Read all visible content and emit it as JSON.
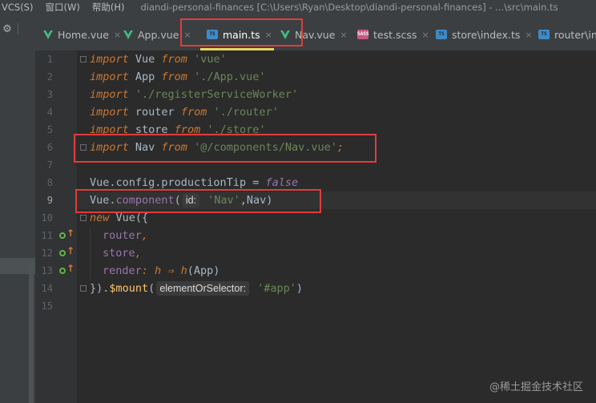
{
  "menu": {
    "items": [
      "VCS(S)",
      "窗口(W)",
      "帮助(H)"
    ],
    "title": "diandi-personal-finances [C:\\Users\\Ryan\\Desktop\\diandi-personal-finances] - ...\\src\\main.ts"
  },
  "left_panel": {
    "gear_icon": "gear-icon"
  },
  "tabs": [
    {
      "label": "Home.vue",
      "icon": "vue-icon"
    },
    {
      "label": "App.vue",
      "icon": "vue-icon"
    },
    {
      "label": "main.ts",
      "icon": "ts-file-icon",
      "badge": "TS",
      "active": true
    },
    {
      "label": "Nav.vue",
      "icon": "vue-icon"
    },
    {
      "label": "test.scss",
      "icon": "sass-file-icon",
      "badge": "SASS"
    },
    {
      "label": "store\\index.ts",
      "icon": "ts-file-icon",
      "badge": "TS"
    },
    {
      "label": "router\\in",
      "icon": "ts-file-icon",
      "badge": "TS"
    }
  ],
  "close_glyph": "×",
  "editor": {
    "line_numbers": [
      "1",
      "2",
      "3",
      "4",
      "5",
      "6",
      "7",
      "8",
      "9",
      "10",
      "11",
      "12",
      "13",
      "14",
      "15"
    ],
    "current_line": "9",
    "code": {
      "l1": {
        "kw": "import",
        "id": " Vue ",
        "from": "from",
        "str": " 'vue'"
      },
      "l2": {
        "kw": "import",
        "id": " App ",
        "from": "from",
        "str": " './App.vue'"
      },
      "l3": {
        "kw": "import",
        "str": " './registerServiceWorker'"
      },
      "l4": {
        "kw": "import",
        "id": " router ",
        "from": "from",
        "str": " './router'"
      },
      "l5": {
        "kw": "import",
        "id": " store ",
        "from": "from",
        "str": " './store'"
      },
      "l6": {
        "kw": "import",
        "id": " Nav ",
        "from": "from",
        "str": " '@/components/Nav.vue'",
        "end": ";"
      },
      "l8": {
        "obj": "Vue.config.",
        "prop": "productionTip",
        "eq": " = ",
        "val": "false"
      },
      "l9": {
        "obj": "Vue.",
        "method": "component",
        "paren": "(",
        "hint": "id:",
        "str": " 'Nav'",
        "rest": ",Nav)"
      },
      "l10": {
        "kw": "new",
        "rest": " Vue({"
      },
      "l11": {
        "prop": "router",
        "rest": ","
      },
      "l12": {
        "prop": "store",
        "rest": ","
      },
      "l13": {
        "prop": "render",
        "colon": ": ",
        "param": "h",
        "arrow": " ⇒ ",
        "call": "h",
        "rest": "(App)"
      },
      "l14": {
        "start": "}).",
        "method": "$mount",
        "paren": "(",
        "hint": "elementOrSelector:",
        "str": " '#app'",
        "rest": ")"
      }
    }
  },
  "watermark": "@稀土掘金技术社区",
  "colors": {
    "keyword": "#cc7832",
    "string": "#6a8759",
    "property": "#9876aa",
    "function": "#ffc66d",
    "annotation_box": "#e03c3c",
    "active_tab_underline": "#e4d85f"
  }
}
